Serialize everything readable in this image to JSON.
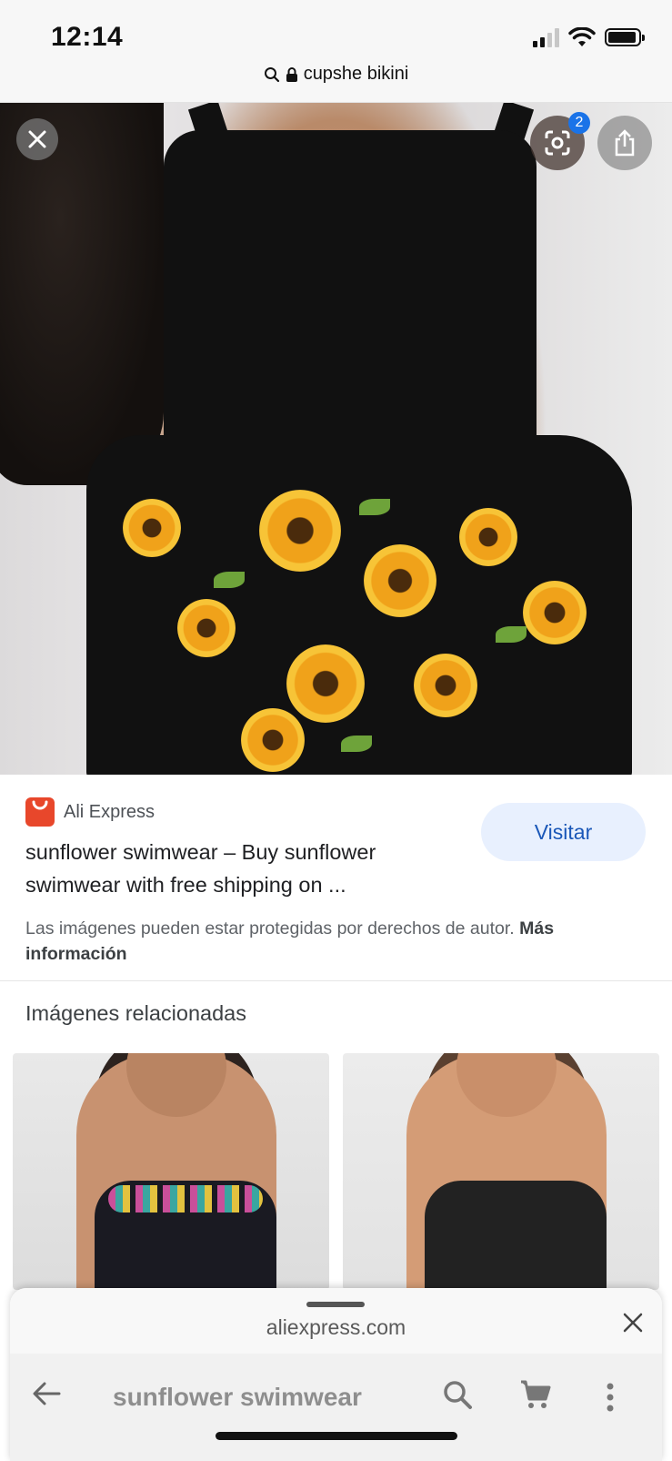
{
  "status_bar": {
    "time": "12:14"
  },
  "url_bar": {
    "text": "cupshe bikini"
  },
  "image_viewer": {
    "lens_badge": "2",
    "close_icon": "close-icon",
    "lens_icon": "google-lens-icon",
    "share_icon": "share-icon"
  },
  "result": {
    "source_name": "Ali Express",
    "title": "sunflower swimwear – Buy sunflower swimwear with free shipping on ...",
    "visit_label": "Visitar",
    "copyright_text": "Las imágenes pueden estar protegidas por derechos de autor.",
    "more_info_label": "Más información"
  },
  "related": {
    "heading": "Imágenes relacionadas"
  },
  "bottom_sheet": {
    "domain": "aliexpress.com",
    "search_query": "sunflower swimwear"
  },
  "colors": {
    "accent": "#1a73e8",
    "visit_bg": "#e8f0fe",
    "aliexpress": "#e8472b"
  }
}
